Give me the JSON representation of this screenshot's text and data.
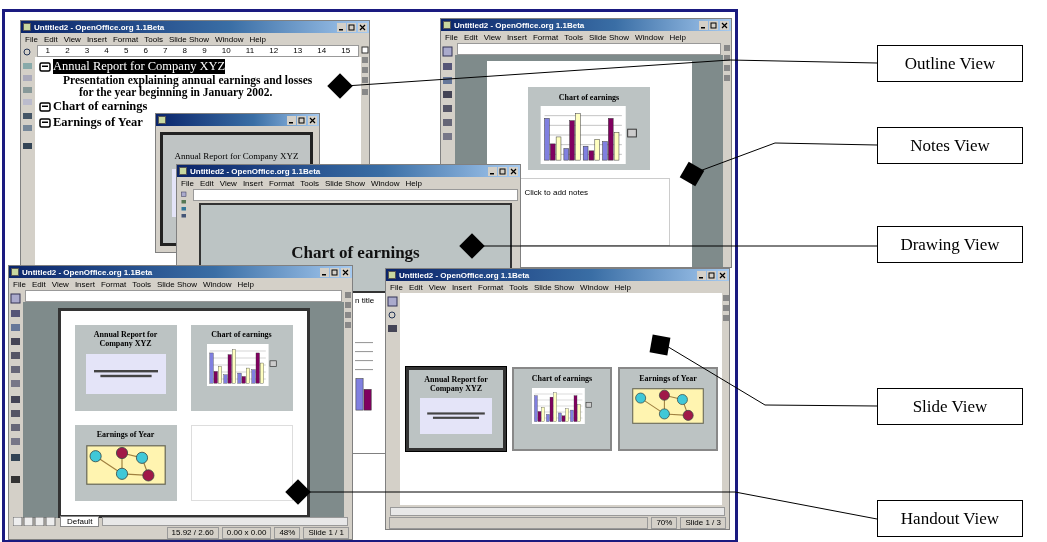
{
  "windows": [
    {
      "kind": "outline",
      "title": "Untitled2 - OpenOffice.org 1.1Beta",
      "menu": [
        "File",
        "Edit",
        "View",
        "Insert",
        "Format",
        "Tools",
        "Slide Show",
        "Window",
        "Help"
      ],
      "ruler": [
        "1",
        "2",
        "3",
        "4",
        "5",
        "6",
        "7",
        "8",
        "9",
        "10",
        "11",
        "12",
        "13",
        "14",
        "15"
      ],
      "items": [
        {
          "title": "Annual Report for Company XYZ",
          "selected": true,
          "notes": [
            "Presentation explaining annual earnings and losses",
            "for the year beginning in January 2002."
          ]
        },
        {
          "title": "Chart of earnings",
          "selected": false
        },
        {
          "title": "Earnings of Year",
          "selected": false
        }
      ]
    },
    {
      "kind": "preview",
      "slide_title": "Annual Report for Company XYZ"
    },
    {
      "kind": "notes",
      "title": "Untitled2 - OpenOffice.org 1.1Beta",
      "menu": [
        "File",
        "Edit",
        "View",
        "Insert",
        "Format",
        "Tools",
        "Slide Show",
        "Window",
        "Help"
      ],
      "slide_title": "Chart of earnings",
      "notes_placeholder": "Click to add notes"
    },
    {
      "kind": "drawing",
      "title": "Untitled2 - OpenOffice.org 1.1Beta",
      "menu": [
        "File",
        "Edit",
        "View",
        "Insert",
        "Format",
        "Tools",
        "Slide Show",
        "Window",
        "Help"
      ],
      "slide_title": "Chart of earnings",
      "side_text": "n title"
    },
    {
      "kind": "handout",
      "title": "Untitled2 - OpenOffice.org 1.1Beta",
      "menu": [
        "File",
        "Edit",
        "View",
        "Insert",
        "Format",
        "Tools",
        "Slide Show",
        "Window",
        "Help"
      ],
      "thumbnails": [
        {
          "kind": "text",
          "title": "Annual Report for Company XYZ",
          "selected": false
        },
        {
          "kind": "chart",
          "title": "Chart of earnings",
          "selected": false
        },
        {
          "kind": "diagram",
          "title": "Earnings of Year",
          "selected": false
        },
        {
          "kind": "empty",
          "selected": false
        }
      ],
      "tab": "Default",
      "status": [
        "15.92 / 2.60",
        "0.00 x 0.00",
        "48%",
        "Slide 1 / 1"
      ]
    },
    {
      "kind": "slides",
      "title": "Untitled2 - OpenOffice.org 1.1Beta",
      "menu": [
        "File",
        "Edit",
        "View",
        "Insert",
        "Format",
        "Tools",
        "Slide Show",
        "Window",
        "Help"
      ],
      "thumbnails": [
        {
          "kind": "text",
          "title": "Annual Report for Company XYZ",
          "selected": true
        },
        {
          "kind": "chart",
          "title": "Chart of earnings",
          "selected": false
        },
        {
          "kind": "diagram",
          "title": "Earnings of Year",
          "selected": false
        }
      ],
      "status": [
        "70%",
        "Slide 1 / 3"
      ]
    }
  ],
  "callouts": [
    {
      "label": "Outline View"
    },
    {
      "label": "Notes View"
    },
    {
      "label": "Drawing View"
    },
    {
      "label": "Slide View"
    },
    {
      "label": "Handout View"
    }
  ]
}
